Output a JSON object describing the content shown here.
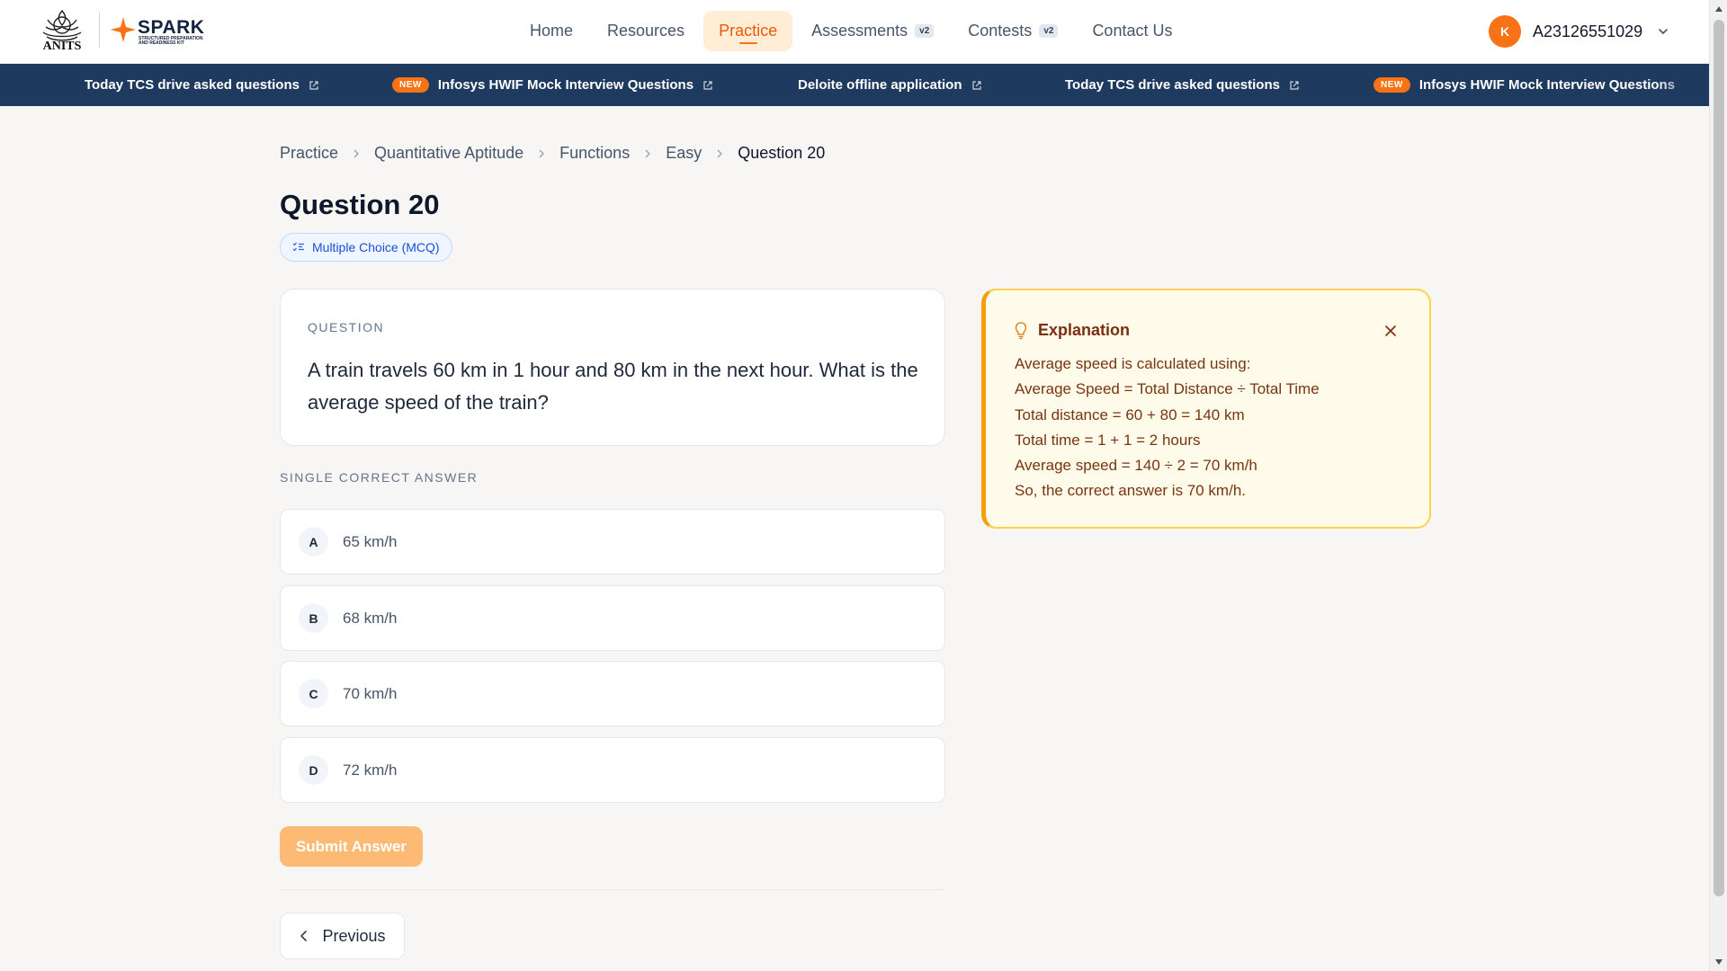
{
  "brand": {
    "anits_label": "ANITS",
    "spark_label": "SPARK",
    "spark_tagline": "STRUCTURED PREPARATION AND READINESS KIT",
    "accent_color": "#f97316",
    "ticker_bg": "#1e3a5f"
  },
  "nav": {
    "items": [
      {
        "label": "Home",
        "badge": ""
      },
      {
        "label": "Resources",
        "badge": ""
      },
      {
        "label": "Practice",
        "badge": ""
      },
      {
        "label": "Assessments",
        "badge": "v2"
      },
      {
        "label": "Contests",
        "badge": "v2"
      },
      {
        "label": "Contact Us",
        "badge": ""
      }
    ],
    "active": "Practice"
  },
  "user": {
    "initial": "K",
    "id": "A23126551029"
  },
  "ticker": {
    "items": [
      {
        "label": "Today TCS drive asked questions",
        "new": false
      },
      {
        "label": "Infosys HWIF Mock Interview Questions",
        "new": true,
        "badge": "NEW"
      },
      {
        "label": "Deloite offline application",
        "new": false
      },
      {
        "label": "Today TCS drive asked questions",
        "new": false
      },
      {
        "label": "Infosys HWIF Mock Interview Questions",
        "new": true,
        "badge": "NEW"
      }
    ]
  },
  "breadcrumb": [
    "Practice",
    "Quantitative Aptitude",
    "Functions",
    "Easy",
    "Question 20"
  ],
  "page": {
    "title": "Question 20",
    "type_label": "Multiple Choice (MCQ)"
  },
  "question": {
    "label": "QUESTION",
    "text": "A train travels 60 km in 1 hour and 80 km in the next hour. What is the average speed of the train?"
  },
  "answers": {
    "label": "SINGLE CORRECT ANSWER",
    "options": [
      {
        "letter": "A",
        "text": "65 km/h"
      },
      {
        "letter": "B",
        "text": "68 km/h"
      },
      {
        "letter": "C",
        "text": "70 km/h"
      },
      {
        "letter": "D",
        "text": "72 km/h"
      }
    ]
  },
  "actions": {
    "submit_label": "Submit Answer",
    "previous_label": "Previous"
  },
  "explanation": {
    "title": "Explanation",
    "lines": [
      "Average speed is calculated using:",
      "Average Speed = Total Distance ÷ Total Time",
      "Total distance = 60 + 80 = 140 km",
      "Total time = 1 + 1 = 2 hours",
      "Average speed = 140 ÷ 2 = 70 km/h",
      "So, the correct answer is 70 km/h."
    ]
  }
}
